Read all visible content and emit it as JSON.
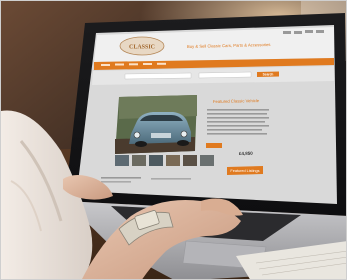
{
  "site": {
    "logo_text": "CLASSIC",
    "tagline": "Buy & Sell Classic Cars, Parts & Accessories",
    "search_button": "Search",
    "featured_title": "Featured Classic Vehicle",
    "price": "£4,850",
    "featured_link": "Featured Listings"
  },
  "colors": {
    "accent": "#e07a1f",
    "page_bg": "#d9d9d9",
    "car_blue": "#6d8fa0"
  }
}
